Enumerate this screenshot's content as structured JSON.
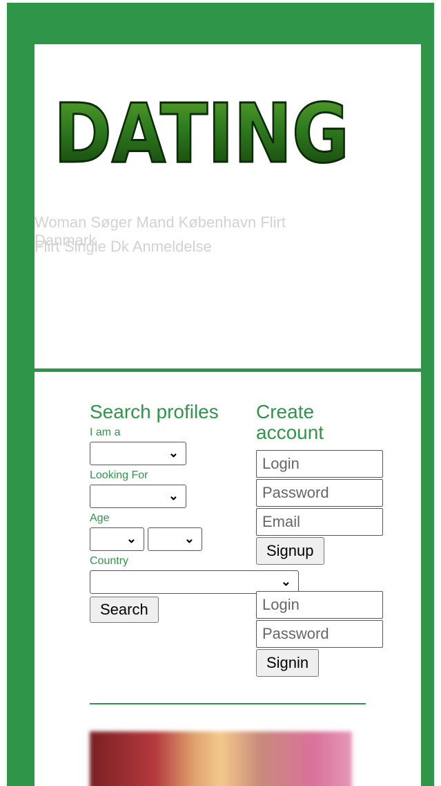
{
  "colors": {
    "brand_green": "#2f9549",
    "logo_green": "#2e7a1e"
  },
  "header": {
    "logo_text": "DATING",
    "taglines": [
      "Woman Søger Mand København Flirt",
      "Danmark",
      "Flirt Single Dk Anmeldelse"
    ]
  },
  "search": {
    "heading": "Search profiles",
    "i_am_label": "I am a",
    "looking_for_label": "Looking For",
    "age_label": "Age",
    "country_label": "Country",
    "i_am_value": "",
    "looking_for_value": "",
    "age_min_value": "",
    "age_max_value": "",
    "country_value": "",
    "search_button": "Search"
  },
  "create_account": {
    "heading": "Create account",
    "login_placeholder": "Login",
    "password_placeholder": "Password",
    "email_placeholder": "Email",
    "signup_button": "Signup"
  },
  "signin": {
    "login_placeholder": "Login",
    "password_placeholder": "Password",
    "signin_button": "Signin"
  },
  "icons": {
    "dropdown": "chevron-down-icon"
  }
}
